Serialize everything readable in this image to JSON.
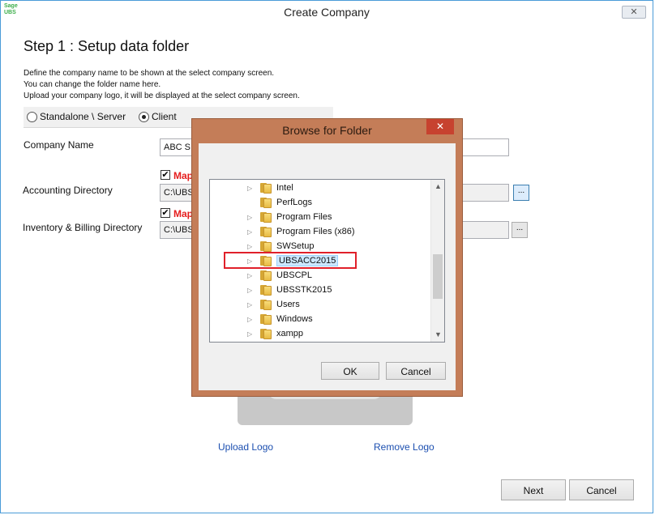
{
  "window": {
    "title": "Create Company",
    "close_label": "✕",
    "logo_line1": "Sage",
    "logo_line2": "UBS"
  },
  "page": {
    "step_title": "Step 1 : Setup data folder",
    "desc_line1": "Define the company name to be shown at the select company screen.",
    "desc_line2": "You can change the folder name here.",
    "desc_line3": "Upload your company logo, it will be displayed at the select company screen."
  },
  "mode": {
    "standalone_label": "Standalone \\ Server",
    "client_label": "Client",
    "selected": "Client"
  },
  "form": {
    "company_name_label": "Company Name",
    "company_name_value": "ABC S",
    "accounting_dir_label": "Accounting Directory",
    "accounting_map_label": "Map",
    "accounting_dir_value": "C:\\UBS",
    "inventory_dir_label": "Inventory & Billing Directory",
    "inventory_map_label": "Map",
    "inventory_dir_value": "C:\\UBS",
    "browse_label": "..."
  },
  "logo": {
    "upload_label": "Upload Logo",
    "remove_label": "Remove Logo"
  },
  "footer": {
    "next_label": "Next",
    "cancel_label": "Cancel"
  },
  "browse_dialog": {
    "title": "Browse for Folder",
    "close_label": "✕",
    "folders": [
      {
        "name": "Intel",
        "expandable": true
      },
      {
        "name": "PerfLogs",
        "expandable": false
      },
      {
        "name": "Program Files",
        "expandable": true
      },
      {
        "name": "Program Files (x86)",
        "expandable": true
      },
      {
        "name": "SWSetup",
        "expandable": true
      },
      {
        "name": "UBSACC2015",
        "expandable": true,
        "selected": true
      },
      {
        "name": "UBSCPL",
        "expandable": true
      },
      {
        "name": "UBSSTK2015",
        "expandable": true
      },
      {
        "name": "Users",
        "expandable": true
      },
      {
        "name": "Windows",
        "expandable": true
      },
      {
        "name": "xampp",
        "expandable": true
      }
    ],
    "ok_label": "OK",
    "cancel_label": "Cancel",
    "highlight_color": "#e0202a"
  }
}
